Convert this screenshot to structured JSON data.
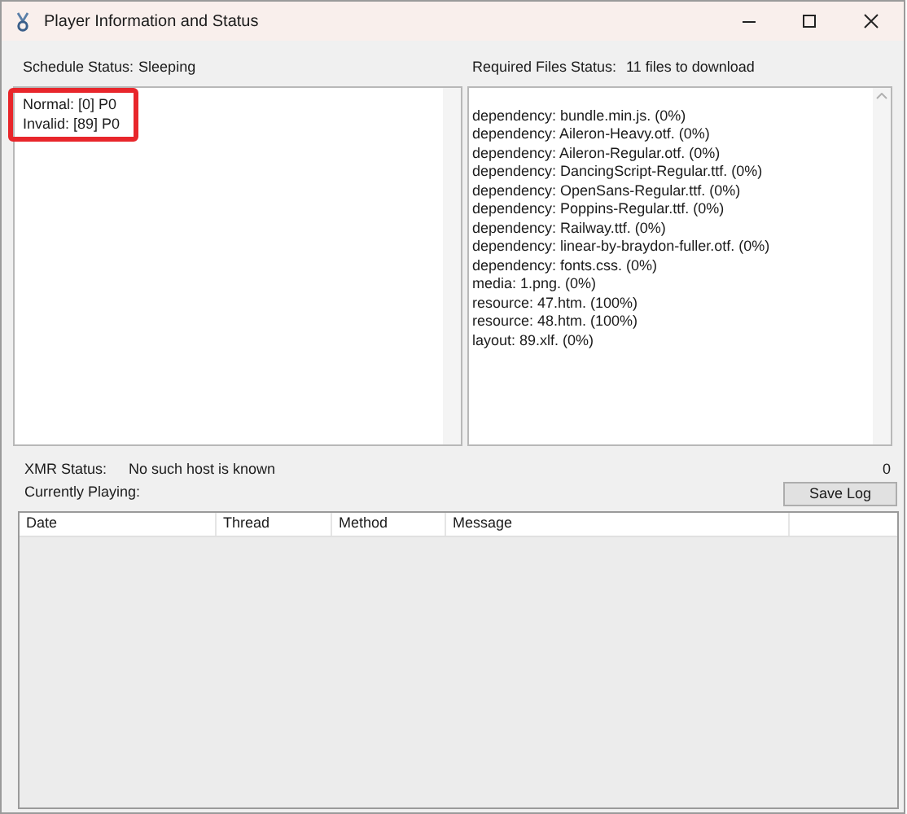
{
  "window": {
    "title": "Player Information and Status"
  },
  "schedule": {
    "label": "Schedule Status:",
    "value": "Sleeping",
    "lines": [
      "Normal: [0]  P0",
      "Invalid: [89]  P0"
    ]
  },
  "required_files": {
    "label": "Required Files Status:",
    "value": "11 files to download",
    "lines": [
      "dependency: bundle.min.js. (0%)",
      "dependency: Aileron-Heavy.otf. (0%)",
      "dependency: Aileron-Regular.otf. (0%)",
      "dependency: DancingScript-Regular.ttf. (0%)",
      "dependency: OpenSans-Regular.ttf. (0%)",
      "dependency: Poppins-Regular.ttf. (0%)",
      "dependency: Railway.ttf. (0%)",
      "dependency: linear-by-braydon-fuller.otf. (0%)",
      "dependency: fonts.css. (0%)",
      "media: 1.png. (0%)",
      "resource: 47.htm. (100%)",
      "resource: 48.htm. (100%)",
      "layout: 89.xlf. (0%)"
    ]
  },
  "xmr": {
    "label": "XMR Status:",
    "value": "No such host is known",
    "count": "0"
  },
  "currently_playing": {
    "label": "Currently Playing:"
  },
  "save_button": "Save Log",
  "log_table": {
    "columns": [
      "Date",
      "Thread",
      "Method",
      "Message"
    ]
  }
}
